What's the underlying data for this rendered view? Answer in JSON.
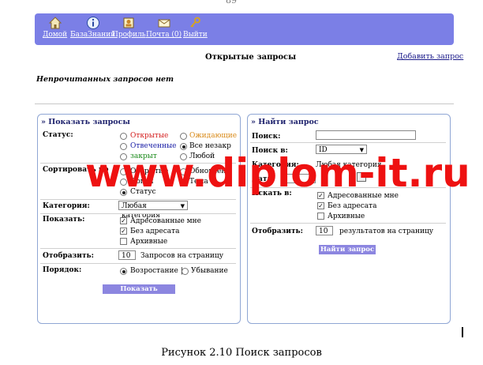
{
  "page_number": "89",
  "nav": {
    "items": [
      {
        "label": "Домой",
        "icon": "home-icon"
      },
      {
        "label": "БазаЗнаний",
        "icon": "info-icon"
      },
      {
        "label": "Профиль",
        "icon": "profile-icon"
      },
      {
        "label": "Почта (0)",
        "icon": "mail-icon"
      },
      {
        "label": "Выйти",
        "icon": "key-icon"
      }
    ]
  },
  "header": {
    "title": "Открытые запросы",
    "add_link": "Добавить запрос"
  },
  "notice": "Непрочитанных запросов нет",
  "show_panel": {
    "title": "» Показать запросы",
    "status_label": "Статус:",
    "status_options": [
      {
        "label": "Открытые",
        "color": "#d42020",
        "checked": false
      },
      {
        "label": "Ожидающие",
        "color": "#d98a18",
        "checked": false
      },
      {
        "label": "Отвеченные",
        "color": "#1d22a8",
        "checked": false
      },
      {
        "label": "Все незакр",
        "color": "#000000",
        "checked": true
      },
      {
        "label": "закрыт",
        "color": "#1a8a1a",
        "checked": false
      },
      {
        "label": "Любой",
        "color": "#000000",
        "checked": false
      }
    ],
    "sort_label": "Сортировать по",
    "sort_options": [
      "Открытые",
      "Обновлен",
      "Логин",
      "Тема",
      "Статус"
    ],
    "category_label": "Категория:",
    "category_value": "Любая категория",
    "show_label": "Показать:",
    "show_options": [
      {
        "label": "Адресованные мне",
        "checked": true
      },
      {
        "label": "Без адресата",
        "checked": true
      },
      {
        "label": "Архивные",
        "checked": false
      }
    ],
    "display_label": "Отобразить:",
    "display_value": "10",
    "display_suffix": "Запросов на страницу",
    "order_label": "Порядок:",
    "order_asc": "Возростание |",
    "order_desc": "Убывание",
    "button": "Показать запросы"
  },
  "find_panel": {
    "title": "» Найти запрос",
    "search_label": "Поиск:",
    "search_value": "",
    "search_in_label": "Поиск в:",
    "search_in_value": "ID",
    "category_label": "Категория:",
    "category_value": "Любая категория",
    "date_label": "Дата:",
    "look_label": "Искать в:",
    "look_options": [
      {
        "label": "Адресованные мне",
        "checked": true
      },
      {
        "label": "Без адресата",
        "checked": true
      },
      {
        "label": "Архивные",
        "checked": false
      }
    ],
    "display_label": "Отобразить:",
    "display_value": "10",
    "display_suffix": "результатов на страницу",
    "button": "Найти запрос"
  },
  "watermark": "www.diplom-it.ru",
  "caption": "Рисунок 2.10 Поиск запросов"
}
